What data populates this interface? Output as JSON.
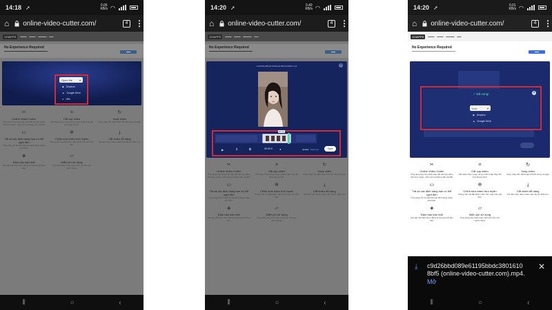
{
  "phones": [
    {
      "id": "phone-1",
      "status": {
        "time": "14:18",
        "net_speed": "0.05",
        "net_unit": "KB/s"
      },
      "browser": {
        "url": "online-video-cutter.com/",
        "tab_count": "4"
      },
      "ad": {
        "title": "No Experience Required"
      },
      "hero": {
        "open_button": "Open file",
        "menu": [
          "Dropbox",
          "Google Drive",
          "URL"
        ]
      }
    },
    {
      "id": "phone-2",
      "status": {
        "time": "14:20",
        "net_speed": "0.40",
        "net_unit": "KB/s"
      },
      "browser": {
        "url": "online-video-cutter.com/",
        "tab_count": "4"
      },
      "ad": {
        "title": "No Experience Required"
      },
      "editor": {
        "file_name": "c9d26bbd089e61195bbdc38016108bf5.mp4",
        "quality_label": "Quality:",
        "quality_value": "Same as",
        "save_button": "Save",
        "duration": "00:09.0",
        "time_marker": "00:06"
      }
    },
    {
      "id": "phone-3",
      "status": {
        "time": "14:20",
        "net_speed": "0.01",
        "net_unit": "KB/s"
      },
      "browser": {
        "url": "online-video-cutter.com/",
        "tab_count": "4"
      },
      "ad": {
        "title": "No Experience Required"
      },
      "done_dialog": {
        "title": "Đã xong!",
        "save_button": "Lưu",
        "menu": [
          "Dropbox",
          "Google Drive"
        ]
      },
      "download": {
        "file_line_1": "c9d26bbd089e61195bbdc3801610",
        "file_line_2": "8bf5 (online-video-cutter.com).mp4.",
        "open_action": "Mở"
      }
    }
  ],
  "features": [
    {
      "icon": "scissors-icon",
      "title": "Online Video Cutter",
      "text": "Ứng dụng này cho phép bạn cắt các tệp video nhỏ trực tuyến, miễn phí và không cần cài đặt."
    },
    {
      "icon": "crop-icon",
      "title": "Cắt cúp video",
      "text": "Cắt video theo vùng mong muốn hoặc thay đổi tỷ lệ khung hình."
    },
    {
      "icon": "rotate-icon",
      "title": "Xoay video",
      "text": "Xoay video 90, 180 hoặc 270 độ trong vài giây."
    },
    {
      "icon": "monitor-icon",
      "title": "Tất cả các định dạng bạn có thể nghĩ đến",
      "text": "Ứng dụng hỗ trợ hầu hết các định dạng video phổ biến."
    },
    {
      "icon": "globe-icon",
      "title": "Chỉnh sửa video trực tuyến",
      "text": "Không cần cài đặt phần mềm trên máy tính của bạn."
    },
    {
      "icon": "download-icon",
      "title": "Cắt video dễ dàng",
      "text": "Chỉ cần chọn đoạn video cần cắt và nhấn lưu."
    },
    {
      "icon": "shield-icon",
      "title": "Đảm bảo bảo mật",
      "text": "Các tệp của bạn sẽ tự động bị xóa sau khi làm việc."
    },
    {
      "icon": "ticket-icon",
      "title": "Miễn phí sử dụng",
      "text": "Ứng dụng này hoàn toàn miễn phí cho mọi người dùng."
    }
  ],
  "colors": {
    "highlight": "#d42a3a",
    "hero_bg": "#0f1c4d",
    "save_blue": "#3a6fe0"
  }
}
